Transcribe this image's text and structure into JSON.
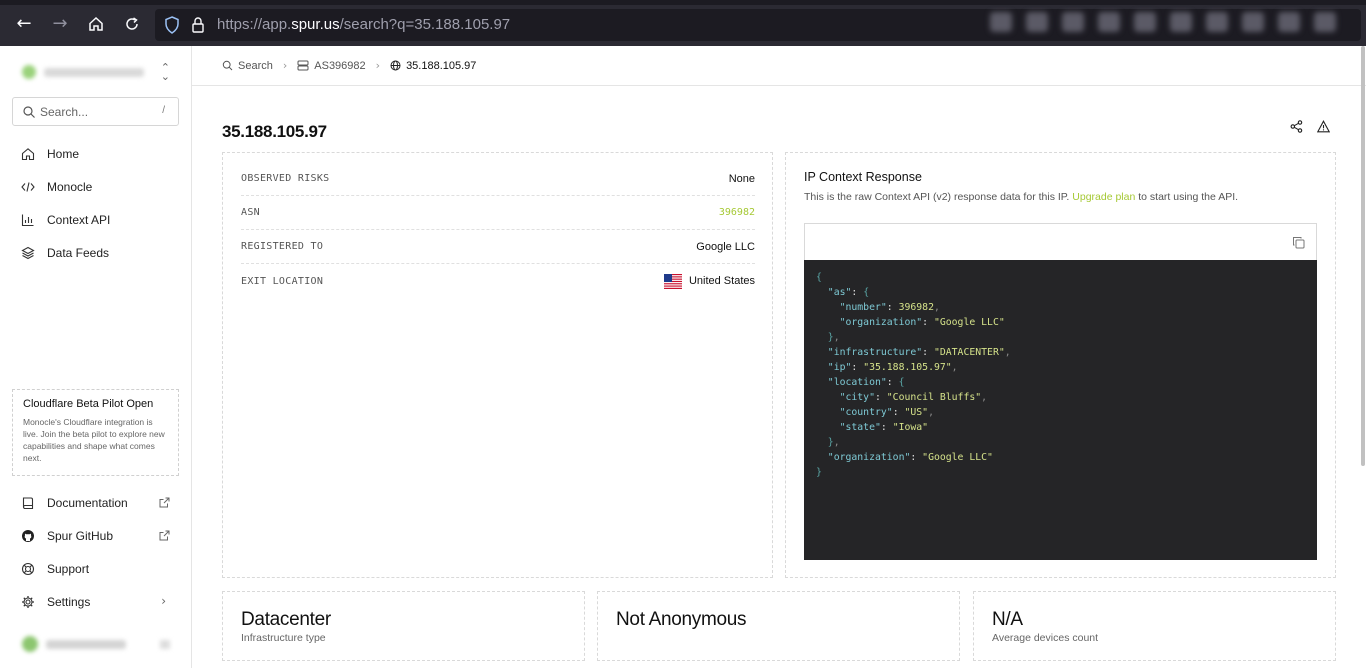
{
  "browser": {
    "url_prefix": "https://app.",
    "url_domain": "spur.us",
    "url_suffix": "/search?q=35.188.105.97"
  },
  "sidebar": {
    "search_placeholder": "Search...",
    "search_shortcut": "/",
    "nav": [
      {
        "label": "Home",
        "icon": "home-icon"
      },
      {
        "label": "Monocle",
        "icon": "code-icon"
      },
      {
        "label": "Context API",
        "icon": "bar-chart-icon"
      },
      {
        "label": "Data Feeds",
        "icon": "layers-icon"
      }
    ],
    "promo": {
      "title": "Cloudflare Beta Pilot Open",
      "text": "Monocle's Cloudflare integration is live. Join the beta pilot to explore new capabilities and shape what comes next."
    },
    "footer_nav": [
      {
        "label": "Documentation",
        "icon": "book-icon"
      },
      {
        "label": "Spur GitHub",
        "icon": "github-icon"
      },
      {
        "label": "Support",
        "icon": "lifebuoy-icon"
      },
      {
        "label": "Settings",
        "icon": "gear-icon"
      }
    ]
  },
  "breadcrumb": {
    "search": "Search",
    "asn": "AS396982",
    "ip": "35.188.105.97"
  },
  "page": {
    "title": "35.188.105.97"
  },
  "details": {
    "rows": [
      {
        "key": "OBSERVED RISKS",
        "value": "None"
      },
      {
        "key": "ASN",
        "value": "396982"
      },
      {
        "key": "REGISTERED TO",
        "value": "Google LLC"
      },
      {
        "key": "EXIT LOCATION",
        "value": "United States"
      }
    ]
  },
  "context": {
    "title": "IP Context Response",
    "desc_before": "This is the raw Context API (v2) response data for this IP. ",
    "desc_link": "Upgrade plan",
    "desc_after": " to start using the API.",
    "json": {
      "as_number": "396982",
      "as_org": "\"Google LLC\"",
      "infrastructure": "\"DATACENTER\"",
      "ip": "\"35.188.105.97\"",
      "city": "\"Council Bluffs\"",
      "country": "\"US\"",
      "state": "\"Iowa\"",
      "organization": "\"Google LLC\""
    }
  },
  "stats": [
    {
      "value": "Datacenter",
      "label": "Infrastructure type"
    },
    {
      "value": "Not Anonymous",
      "label": ""
    },
    {
      "value": "N/A",
      "label": "Average devices count"
    }
  ],
  "colors": {
    "accent": "#a6c935",
    "code_bg": "#252527"
  }
}
